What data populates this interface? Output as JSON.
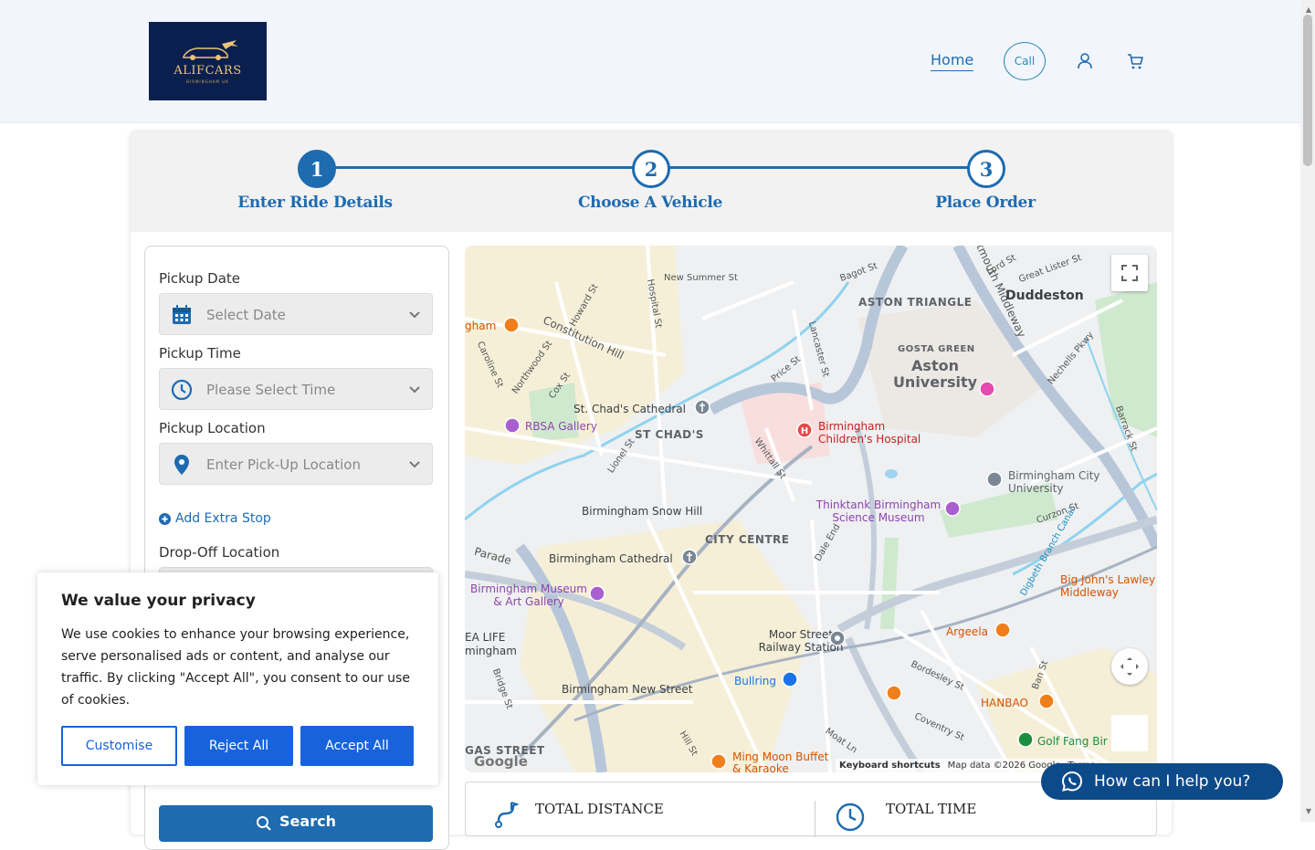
{
  "header": {
    "logo_text": "ALIFCARS",
    "logo_sub": "BIRMINGHAM UK",
    "nav_home": "Home",
    "nav_call": "Call",
    "icons": [
      "user-icon",
      "cart-icon"
    ]
  },
  "steps": [
    {
      "number": "1",
      "label": "Enter Ride Details",
      "active": true
    },
    {
      "number": "2",
      "label": "Choose A Vehicle",
      "active": false
    },
    {
      "number": "3",
      "label": "Place Order",
      "active": false
    }
  ],
  "form": {
    "pickup_date_label": "Pickup Date",
    "pickup_date_placeholder": "Select Date",
    "pickup_time_label": "Pickup Time",
    "pickup_time_placeholder": "Please Select Time",
    "pickup_location_label": "Pickup Location",
    "pickup_location_placeholder": "Enter Pick-Up Location",
    "add_stop": "Add Extra Stop",
    "dropoff_label": "Drop-Off Location",
    "search_button": "Search"
  },
  "map": {
    "labels": {
      "aston_triangle": "ASTON TRIANGLE",
      "duddeston": "Duddeston",
      "gosta_green": "GOSTA GREEN",
      "aston_university": "Aston University",
      "st_chads": "ST CHAD'S",
      "st_chads_cathedral": "St. Chad's Cathedral",
      "rbsa_gallery": "RBSA Gallery",
      "childrens_hospital": "Birmingham Children's Hospital",
      "bcu": "Birmingham City University",
      "snow_hill": "Birmingham Snow Hill",
      "thinktank": "Thinktank Birmingham Science Museum",
      "city_centre": "CITY CENTRE",
      "birmingham_cathedral": "Birmingham Cathedral",
      "museum": "Birmingham Museum & Art Gallery",
      "moor_street": "Moor Street Railway Station",
      "argeela": "Argeela",
      "big_johns": "Big John's Lawley Middleway",
      "bullring": "Bullring",
      "new_street": "Birmingham New Street",
      "hanbao": "HANBAO",
      "golf_fang": "Golf Fang Bir",
      "ming_moon": "Ming Moon Buffet & Karaoke",
      "gas_street": "GAS STREET",
      "sea_life": "EA LIFE mingham",
      "constitution_hill": "Constitution Hill",
      "new_summer_st": "New Summer St",
      "lancaster_st": "Lancaster St",
      "curzon_st": "Curzon St",
      "nechells_pkwy": "Nechells Pkwy",
      "moat_ln": "Moat Ln",
      "bordesley_st": "Bordesley St",
      "coventry_st": "Coventry St",
      "dale_end": "Dale End",
      "whittall_st": "Whittall St",
      "price_st": "Price St",
      "lionel_st": "Lionel St",
      "bridge_st": "Bridge St",
      "parade": "Parade",
      "howard_st": "Howard St",
      "hospital_st": "Hospital St",
      "northwood_st": "Northwood St",
      "cox_st": "Cox St",
      "caroline_st": "Caroline St",
      "bagot_st": "Bagot St",
      "lord_st": "Lord St",
      "great_lister_st": "Great Lister St",
      "dartmouth_middleway": "rtmouth Middleway",
      "barrack_st": "Barrack St",
      "digbeth_canal": "Digbeth Branch Canal",
      "ban_st": "Ban St",
      "hill_st": "Hill St",
      "gham": "gham"
    },
    "footer": {
      "shortcuts": "Keyboard shortcuts",
      "data": "Map data ©2026 Google",
      "terms": "Terms"
    },
    "google": "Google"
  },
  "totals": {
    "distance_label": "TOTAL DISTANCE",
    "time_label": "TOTAL TIME"
  },
  "cookie": {
    "title": "We value your privacy",
    "text": "We use cookies to enhance your browsing experience, serve personalised ads or content, and analyse our traffic. By clicking \"Accept All\", you consent to our use of cookies.",
    "customise": "Customise",
    "reject": "Reject All",
    "accept": "Accept All"
  },
  "whatsapp": {
    "label": "How can I help you?"
  },
  "colors": {
    "primary": "#1e6bb0",
    "logo_bg": "#0b1f4f",
    "cookie_blue": "#1863dc",
    "whatsapp_bg": "#0d4a8a"
  }
}
